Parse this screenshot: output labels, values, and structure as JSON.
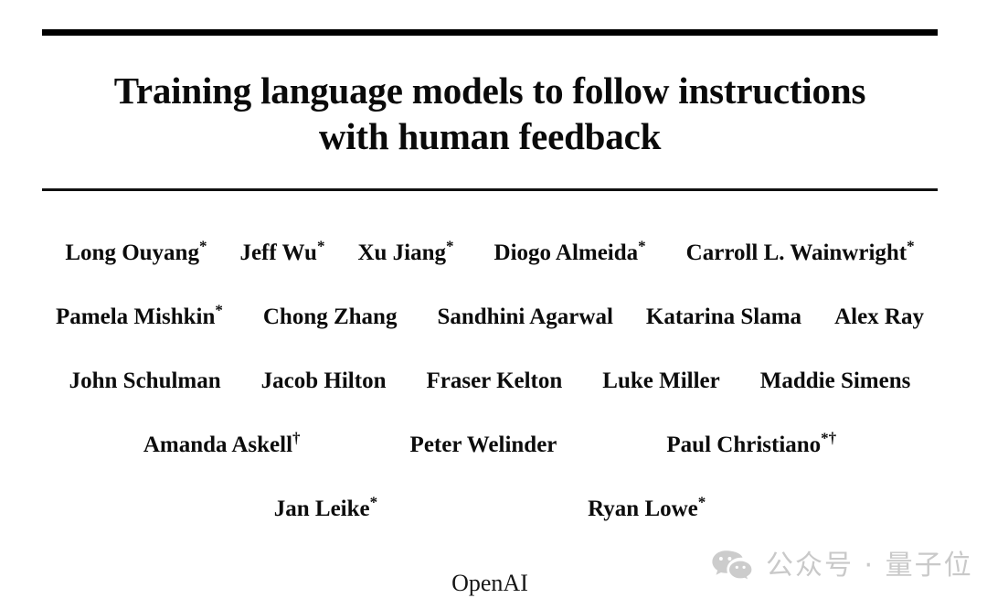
{
  "document": {
    "title_lines": [
      "Training language models to follow instructions",
      "with human feedback"
    ],
    "affiliation": "OpenAI",
    "author_rows": [
      {
        "authors": [
          {
            "name": "Long Ouyang",
            "mark": "*"
          },
          {
            "name": "Jeff Wu",
            "mark": "*"
          },
          {
            "name": "Xu Jiang",
            "mark": "*"
          },
          {
            "name": "Diogo Almeida",
            "mark": "*"
          },
          {
            "name": "Carroll L. Wainwright",
            "mark": "*"
          }
        ]
      },
      {
        "authors": [
          {
            "name": "Pamela Mishkin",
            "mark": "*"
          },
          {
            "name": "Chong Zhang",
            "mark": ""
          },
          {
            "name": "Sandhini Agarwal",
            "mark": ""
          },
          {
            "name": "Katarina Slama",
            "mark": ""
          },
          {
            "name": "Alex Ray",
            "mark": ""
          }
        ]
      },
      {
        "authors": [
          {
            "name": "John Schulman",
            "mark": ""
          },
          {
            "name": "Jacob Hilton",
            "mark": ""
          },
          {
            "name": "Fraser Kelton",
            "mark": ""
          },
          {
            "name": "Luke Miller",
            "mark": ""
          },
          {
            "name": "Maddie Simens",
            "mark": ""
          }
        ]
      },
      {
        "authors": [
          {
            "name": "Amanda Askell",
            "mark": "†"
          },
          {
            "name": "Peter Welinder",
            "mark": ""
          },
          {
            "name": "Paul Christiano",
            "mark": "*†"
          }
        ]
      },
      {
        "authors": [
          {
            "name": "Jan Leike",
            "mark": "*"
          },
          {
            "name": "Ryan Lowe",
            "mark": "*"
          }
        ]
      }
    ]
  },
  "watermark": {
    "icon": "wechat-icon",
    "text": "公众号 · 量子位",
    "color": "#c9c9c9"
  },
  "colors": {
    "background": "#ffffff",
    "text": "#000000",
    "rule": "#000000",
    "watermark": "#c9c9c9"
  }
}
